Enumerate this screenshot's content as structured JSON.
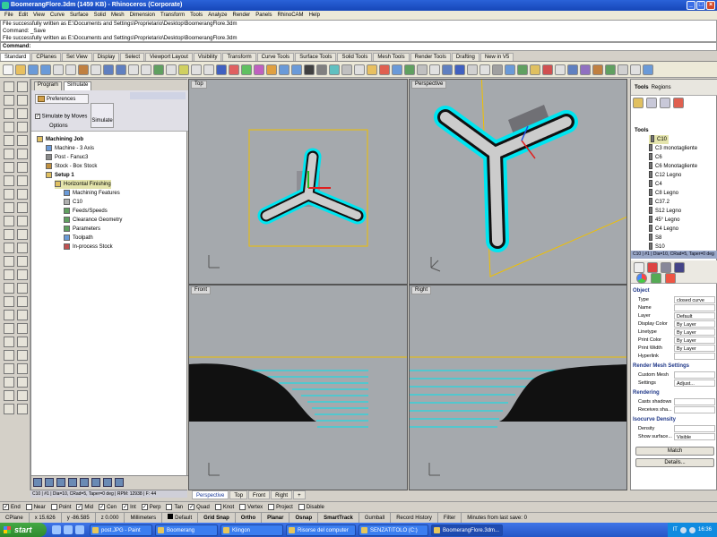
{
  "window": {
    "title": "BoomerangFlore.3dm (1459 KB) - Rhinoceros (Corporate)"
  },
  "menu": [
    "File",
    "Edit",
    "View",
    "Curve",
    "Surface",
    "Solid",
    "Mesh",
    "Dimension",
    "Transform",
    "Tools",
    "Analyze",
    "Render",
    "Panels",
    "RhinoCAM",
    "Help"
  ],
  "command": {
    "history": [
      "File successfully written as E:\\Documents and Settings\\Proprietario\\Desktop\\BoomerangFlore.3dm",
      "Command: _Save",
      "File successfully written as E:\\Documents and Settings\\Proprietario\\Desktop\\BoomerangFlore.3dm"
    ],
    "prompt": "Command:"
  },
  "toolbar_tabs": [
    "Standard",
    "CPlanes",
    "Set View",
    "Display",
    "Select",
    "Viewport Layout",
    "Visibility",
    "Transform",
    "Curve Tools",
    "Surface Tools",
    "Solid Tools",
    "Mesh Tools",
    "Render Tools",
    "Drafting",
    "New in V5"
  ],
  "cam": {
    "tabs": [
      "Program",
      "Simulate"
    ],
    "ribbon": {
      "preferences": "Preferences",
      "simulate_by_moves": "Simulate by Moves",
      "options": "Options",
      "simulate": "Simulate"
    },
    "tree": [
      {
        "label": "Machining Job",
        "level": 0,
        "bold": true
      },
      {
        "label": "Machine - 3 Axis",
        "level": 1
      },
      {
        "label": "Post - Fanuc3",
        "level": 1
      },
      {
        "label": "Stock - Box Stock",
        "level": 1
      },
      {
        "label": "Setup 1",
        "level": 1,
        "bold": true
      },
      {
        "label": "Horizontal Finishing",
        "level": 2,
        "highlight": true
      },
      {
        "label": "Machining Features",
        "level": 3
      },
      {
        "label": "C10",
        "level": 3
      },
      {
        "label": "Feeds/Speeds",
        "level": 3
      },
      {
        "label": "Clearance Geometry",
        "level": 3
      },
      {
        "label": "Parameters",
        "level": 3
      },
      {
        "label": "Toolpath",
        "level": 3
      },
      {
        "label": "In-process Stock",
        "level": 3
      }
    ],
    "status": "C10 | #1 | Dia=10, CRad=5, Taper=0 deg | RPM: 12938 | F: 44"
  },
  "viewports": {
    "top": "Top",
    "perspective": "Perspective",
    "front": "Front",
    "right": "Right"
  },
  "viewport_tabs": [
    "Perspective",
    "Top",
    "Front",
    "Right"
  ],
  "right": {
    "tabs": [
      "Tools",
      "Regions"
    ],
    "tools_root": "Tools",
    "tools": [
      "C10",
      "C3 monotagliente",
      "C6",
      "C6 Monotagliente",
      "C12 Legno",
      "C4",
      "C8 Legno",
      "C37.2",
      "S12 Legno",
      "45° Legno",
      "C4 Legno",
      "S8",
      "S10"
    ],
    "status": "C10 | #1 | Dia=10, CRad=5, Taper=0 deg",
    "sections": {
      "object": "Object",
      "render_mesh": "Render Mesh Settings",
      "rendering": "Rendering",
      "isocurve": "Isocurve Density"
    },
    "properties": [
      {
        "k": "Type",
        "v": "closed curve"
      },
      {
        "k": "Name",
        "v": ""
      },
      {
        "k": "Layer",
        "v": "Default"
      },
      {
        "k": "Display Color",
        "v": "By Layer"
      },
      {
        "k": "Linetype",
        "v": "By Layer"
      },
      {
        "k": "Print Color",
        "v": "By Layer"
      },
      {
        "k": "Print Width",
        "v": "By Layer"
      },
      {
        "k": "Hyperlink",
        "v": ""
      }
    ],
    "render_mesh": [
      {
        "k": "Custom Mesh",
        "v": ""
      },
      {
        "k": "Settings",
        "v": "Adjust..."
      }
    ],
    "rendering": [
      {
        "k": "Casts shadows",
        "v": ""
      },
      {
        "k": "Receives sha...",
        "v": ""
      }
    ],
    "isocurve": [
      {
        "k": "Density",
        "v": ""
      },
      {
        "k": "Show surface...",
        "v": "Visible"
      }
    ],
    "buttons": {
      "match": "Match",
      "details": "Details..."
    }
  },
  "snaps": [
    {
      "label": "End",
      "checked": true
    },
    {
      "label": "Near",
      "checked": false
    },
    {
      "label": "Point",
      "checked": false
    },
    {
      "label": "Mid",
      "checked": true
    },
    {
      "label": "Cen",
      "checked": true
    },
    {
      "label": "Int",
      "checked": true
    },
    {
      "label": "Perp",
      "checked": true
    },
    {
      "label": "Tan",
      "checked": false
    },
    {
      "label": "Quad",
      "checked": true
    },
    {
      "label": "Knot",
      "checked": false
    },
    {
      "label": "Vertex",
      "checked": false
    },
    {
      "label": "Project",
      "checked": false
    },
    {
      "label": "Disable",
      "checked": false
    }
  ],
  "status": {
    "cplane": "CPlane",
    "x": "x 15.626",
    "y": "y -86.585",
    "z": "z 0.000",
    "units": "Millimeters",
    "layer": "Default",
    "grid_snap": "Grid Snap",
    "ortho": "Ortho",
    "planar": "Planar",
    "osnap": "Osnap",
    "smarttrack": "SmartTrack",
    "gumball": "Gumball",
    "record_history": "Record History",
    "filter": "Filter",
    "saved": "Minutes from last save: 0"
  },
  "taskbar": {
    "start": "start",
    "tasks": [
      "post.JPG - Paint",
      "Boomerang",
      "Klingon",
      "Risorse del computer",
      "SENZATITOLO (C:)",
      "BoomerangFlore.3dm..."
    ],
    "lang": "IT",
    "clock": "16:36"
  },
  "colors": {
    "accent": "#00e5f0",
    "stock": "#4c4c52",
    "bounds": "#f0c000",
    "vp_bg": "#a5a9ad"
  }
}
